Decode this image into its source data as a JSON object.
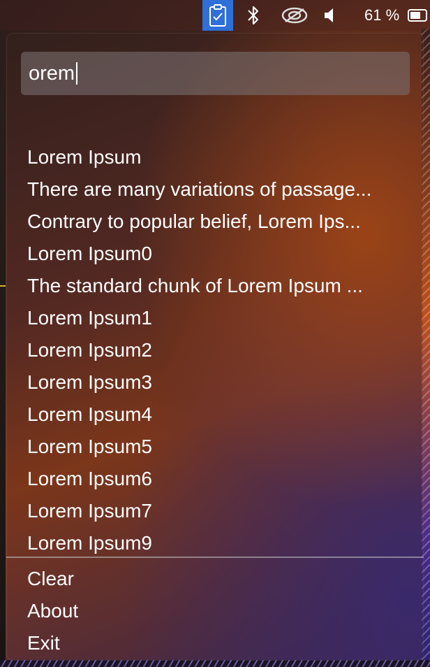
{
  "menubar": {
    "battery_percent_label": "61 %",
    "icons": [
      "clipboard-check-icon",
      "bluetooth-icon",
      "screen-cast-icon",
      "volume-icon",
      "battery-icon"
    ],
    "accent_color": "#2f6fd8"
  },
  "popup": {
    "search": {
      "value": "orem"
    },
    "results": [
      "Lorem Ipsum",
      "There are many variations of passage...",
      "Contrary to popular belief, Lorem Ips...",
      "Lorem Ipsum0",
      "The standard chunk of Lorem Ipsum ...",
      "Lorem Ipsum1",
      "Lorem Ipsum2",
      "Lorem Ipsum3",
      "Lorem Ipsum4",
      "Lorem Ipsum5",
      "Lorem Ipsum6",
      "Lorem Ipsum7",
      "Lorem Ipsum9"
    ],
    "actions": {
      "clear": "Clear",
      "about": "About",
      "exit": "Exit"
    }
  }
}
